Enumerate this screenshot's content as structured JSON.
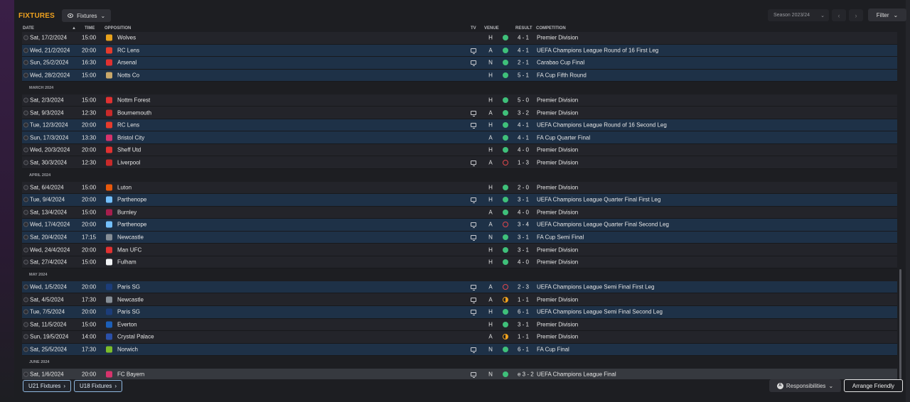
{
  "header": {
    "title": "FIXTURES",
    "view_label": "Fixtures",
    "season_label": "Season 2023/24",
    "filter_label": "Filter"
  },
  "columns": {
    "date": "DATE",
    "time": "TIME",
    "opposition": "OPPOSITION",
    "tv": "TV",
    "venue": "VENUE",
    "result": "RESULT",
    "competition": "COMPETITION"
  },
  "rows": [
    {
      "kind": "match",
      "date": "Sat, 17/2/2024",
      "time": "15:00",
      "opp": "Wolves",
      "crest": "#e8a21c",
      "tv": false,
      "venue": "H",
      "outcome": "win",
      "score": "4 - 1",
      "comp": "Premier Division",
      "style": "plain"
    },
    {
      "kind": "match",
      "date": "Wed, 21/2/2024",
      "time": "20:00",
      "opp": "RC Lens",
      "crest": "#e53b2c",
      "tv": true,
      "venue": "A",
      "outcome": "win",
      "score": "4 - 1",
      "comp": "UEFA Champions League Round of 16  First Leg",
      "style": "hl"
    },
    {
      "kind": "match",
      "date": "Sun, 25/2/2024",
      "time": "16:30",
      "opp": "Arsenal",
      "crest": "#e03131",
      "tv": true,
      "venue": "N",
      "outcome": "win",
      "score": "2 - 1",
      "comp": "Carabao Cup Final",
      "style": "hl"
    },
    {
      "kind": "match",
      "date": "Wed, 28/2/2024",
      "time": "15:00",
      "opp": "Notts Co",
      "crest": "#c9a86a",
      "tv": false,
      "venue": "H",
      "outcome": "win",
      "score": "5 - 1",
      "comp": "FA Cup Fifth Round",
      "style": "hl"
    },
    {
      "kind": "month",
      "label": "MARCH 2024"
    },
    {
      "kind": "match",
      "date": "Sat, 2/3/2024",
      "time": "15:00",
      "opp": "Nottm Forest",
      "crest": "#e03131",
      "tv": false,
      "venue": "H",
      "outcome": "win",
      "score": "5 - 0",
      "comp": "Premier Division",
      "style": "plain"
    },
    {
      "kind": "match",
      "date": "Sat, 9/3/2024",
      "time": "12:30",
      "opp": "Bournemouth",
      "crest": "#c92a2a",
      "tv": true,
      "venue": "A",
      "outcome": "win",
      "score": "3 - 2",
      "comp": "Premier Division",
      "style": "plain"
    },
    {
      "kind": "match",
      "date": "Tue, 12/3/2024",
      "time": "20:00",
      "opp": "RC Lens",
      "crest": "#e53b2c",
      "tv": true,
      "venue": "H",
      "outcome": "win",
      "score": "4 - 1",
      "comp": "UEFA Champions League Round of 16  Second Leg",
      "style": "hl"
    },
    {
      "kind": "match",
      "date": "Sun, 17/3/2024",
      "time": "13:30",
      "opp": "Bristol City",
      "crest": "#d6336c",
      "tv": false,
      "venue": "A",
      "outcome": "win",
      "score": "4 - 1",
      "comp": "FA Cup Quarter Final",
      "style": "hl"
    },
    {
      "kind": "match",
      "date": "Wed, 20/3/2024",
      "time": "20:00",
      "opp": "Sheff Utd",
      "crest": "#e03131",
      "tv": false,
      "venue": "H",
      "outcome": "win",
      "score": "4 - 0",
      "comp": "Premier Division",
      "style": "plain"
    },
    {
      "kind": "match",
      "date": "Sat, 30/3/2024",
      "time": "12:30",
      "opp": "Liverpool",
      "crest": "#c92a2a",
      "tv": true,
      "venue": "A",
      "outcome": "loss",
      "score": "1 - 3",
      "comp": "Premier Division",
      "style": "plain"
    },
    {
      "kind": "month",
      "label": "APRIL 2024"
    },
    {
      "kind": "match",
      "date": "Sat, 6/4/2024",
      "time": "15:00",
      "opp": "Luton",
      "crest": "#e8590c",
      "tv": false,
      "venue": "H",
      "outcome": "win",
      "score": "2 - 0",
      "comp": "Premier Division",
      "style": "plain"
    },
    {
      "kind": "match",
      "date": "Tue, 9/4/2024",
      "time": "20:00",
      "opp": "Parthenope",
      "crest": "#74c0fc",
      "tv": true,
      "venue": "H",
      "outcome": "win",
      "score": "3 - 1",
      "comp": "UEFA Champions League Quarter Final First Leg",
      "style": "hl"
    },
    {
      "kind": "match",
      "date": "Sat, 13/4/2024",
      "time": "15:00",
      "opp": "Burnley",
      "crest": "#a61e4d",
      "tv": false,
      "venue": "A",
      "outcome": "win",
      "score": "4 - 0",
      "comp": "Premier Division",
      "style": "plain"
    },
    {
      "kind": "match",
      "date": "Wed, 17/4/2024",
      "time": "20:00",
      "opp": "Parthenope",
      "crest": "#74c0fc",
      "tv": true,
      "venue": "A",
      "outcome": "loss",
      "score": "3 - 4",
      "comp": "UEFA Champions League Quarter Final Second Leg",
      "style": "hl"
    },
    {
      "kind": "match",
      "date": "Sat, 20/4/2024",
      "time": "17:15",
      "opp": "Newcastle",
      "crest": "#868e96",
      "tv": true,
      "venue": "N",
      "outcome": "win",
      "score": "3 - 1",
      "comp": "FA Cup Semi Final",
      "style": "hl"
    },
    {
      "kind": "match",
      "date": "Wed, 24/4/2024",
      "time": "20:00",
      "opp": "Man UFC",
      "crest": "#e03131",
      "tv": false,
      "venue": "H",
      "outcome": "win",
      "score": "3 - 1",
      "comp": "Premier Division",
      "style": "plain"
    },
    {
      "kind": "match",
      "date": "Sat, 27/4/2024",
      "time": "15:00",
      "opp": "Fulham",
      "crest": "#f1f3f5",
      "tv": false,
      "venue": "H",
      "outcome": "win",
      "score": "4 - 0",
      "comp": "Premier Division",
      "style": "plain"
    },
    {
      "kind": "month",
      "label": "MAY 2024"
    },
    {
      "kind": "match",
      "date": "Wed, 1/5/2024",
      "time": "20:00",
      "opp": "Paris SG",
      "crest": "#1c3d7a",
      "tv": true,
      "venue": "A",
      "outcome": "loss",
      "score": "2 - 3",
      "comp": "UEFA Champions League Semi Final First Leg",
      "style": "hl"
    },
    {
      "kind": "match",
      "date": "Sat, 4/5/2024",
      "time": "17:30",
      "opp": "Newcastle",
      "crest": "#868e96",
      "tv": true,
      "venue": "A",
      "outcome": "draw",
      "score": "1 - 1",
      "comp": "Premier Division",
      "style": "plain"
    },
    {
      "kind": "match",
      "date": "Tue, 7/5/2024",
      "time": "20:00",
      "opp": "Paris SG",
      "crest": "#1c3d7a",
      "tv": true,
      "venue": "H",
      "outcome": "win",
      "score": "6 - 1",
      "comp": "UEFA Champions League Semi Final Second Leg",
      "style": "hl"
    },
    {
      "kind": "match",
      "date": "Sat, 11/5/2024",
      "time": "15:00",
      "opp": "Everton",
      "crest": "#1c5fb8",
      "tv": false,
      "venue": "H",
      "outcome": "win",
      "score": "3 - 1",
      "comp": "Premier Division",
      "style": "plain"
    },
    {
      "kind": "match",
      "date": "Sun, 19/5/2024",
      "time": "14:00",
      "opp": "Crystal Palace",
      "crest": "#2b50a8",
      "tv": false,
      "venue": "A",
      "outcome": "draw",
      "score": "1 - 1",
      "comp": "Premier Division",
      "style": "plain"
    },
    {
      "kind": "match",
      "date": "Sat, 25/5/2024",
      "time": "17:30",
      "opp": "Norwich",
      "crest": "#7cbd2b",
      "tv": true,
      "venue": "N",
      "outcome": "win",
      "score": "6 - 1",
      "comp": "FA Cup Final",
      "style": "hl"
    },
    {
      "kind": "month",
      "label": "JUNE 2024"
    },
    {
      "kind": "match",
      "date": "Sat, 1/6/2024",
      "time": "20:00",
      "opp": "FC Bayern",
      "crest": "#d6336c",
      "tv": true,
      "venue": "N",
      "outcome": "win",
      "score": "e 3 - 2",
      "comp": "UEFA Champions League Final",
      "style": "sel"
    }
  ],
  "footer": {
    "u21_label": "U21 Fixtures",
    "u18_label": "U18 Fixtures",
    "responsibilities_label": "Responsibilities",
    "arrange_label": "Arrange Friendly"
  }
}
